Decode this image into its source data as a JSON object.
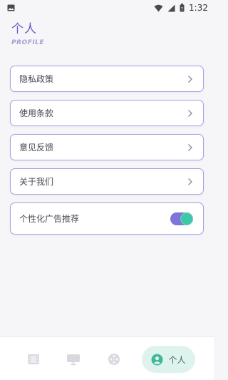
{
  "status_bar": {
    "time": "1:32",
    "icons": [
      "image-icon",
      "wifi-icon",
      "signal-icon",
      "battery-icon"
    ]
  },
  "header": {
    "title": "个人",
    "subtitle": "PROFILE"
  },
  "menu": {
    "items": [
      {
        "label": "隐私政策"
      },
      {
        "label": "使用条款"
      },
      {
        "label": "意见反馈"
      },
      {
        "label": "关于我们"
      }
    ],
    "toggle_item": {
      "label": "个性化广告推荐",
      "enabled": true
    }
  },
  "bottom_nav": {
    "tabs": [
      {
        "icon": "film-icon"
      },
      {
        "icon": "tv-icon"
      },
      {
        "icon": "film-reel-icon"
      },
      {
        "icon": "person-icon",
        "label": "个人",
        "active": true
      }
    ]
  },
  "colors": {
    "accent": "#7f73dc",
    "toggle_knob": "#3fc8a8",
    "active_tab_bg": "#dff3ee",
    "card_border": "#a89fe6"
  }
}
